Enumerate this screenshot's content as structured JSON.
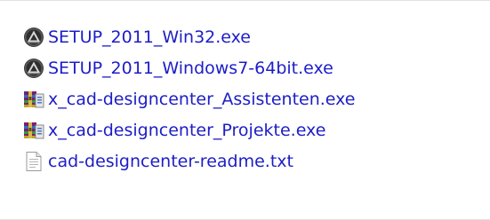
{
  "files": [
    {
      "name": "SETUP_2011_Win32.exe",
      "icon": "setup-exe-icon"
    },
    {
      "name": "SETUP_2011_Windows7-64bit.exe",
      "icon": "setup-exe-icon"
    },
    {
      "name": "x_cad-designcenter_Assistenten.exe",
      "icon": "winrar-sfx-icon"
    },
    {
      "name": "x_cad-designcenter_Projekte.exe",
      "icon": "winrar-sfx-icon"
    },
    {
      "name": "cad-designcenter-readme.txt",
      "icon": "text-document-icon"
    }
  ],
  "colors": {
    "link_text": "#1d1dc8",
    "background": "#ffffff"
  }
}
